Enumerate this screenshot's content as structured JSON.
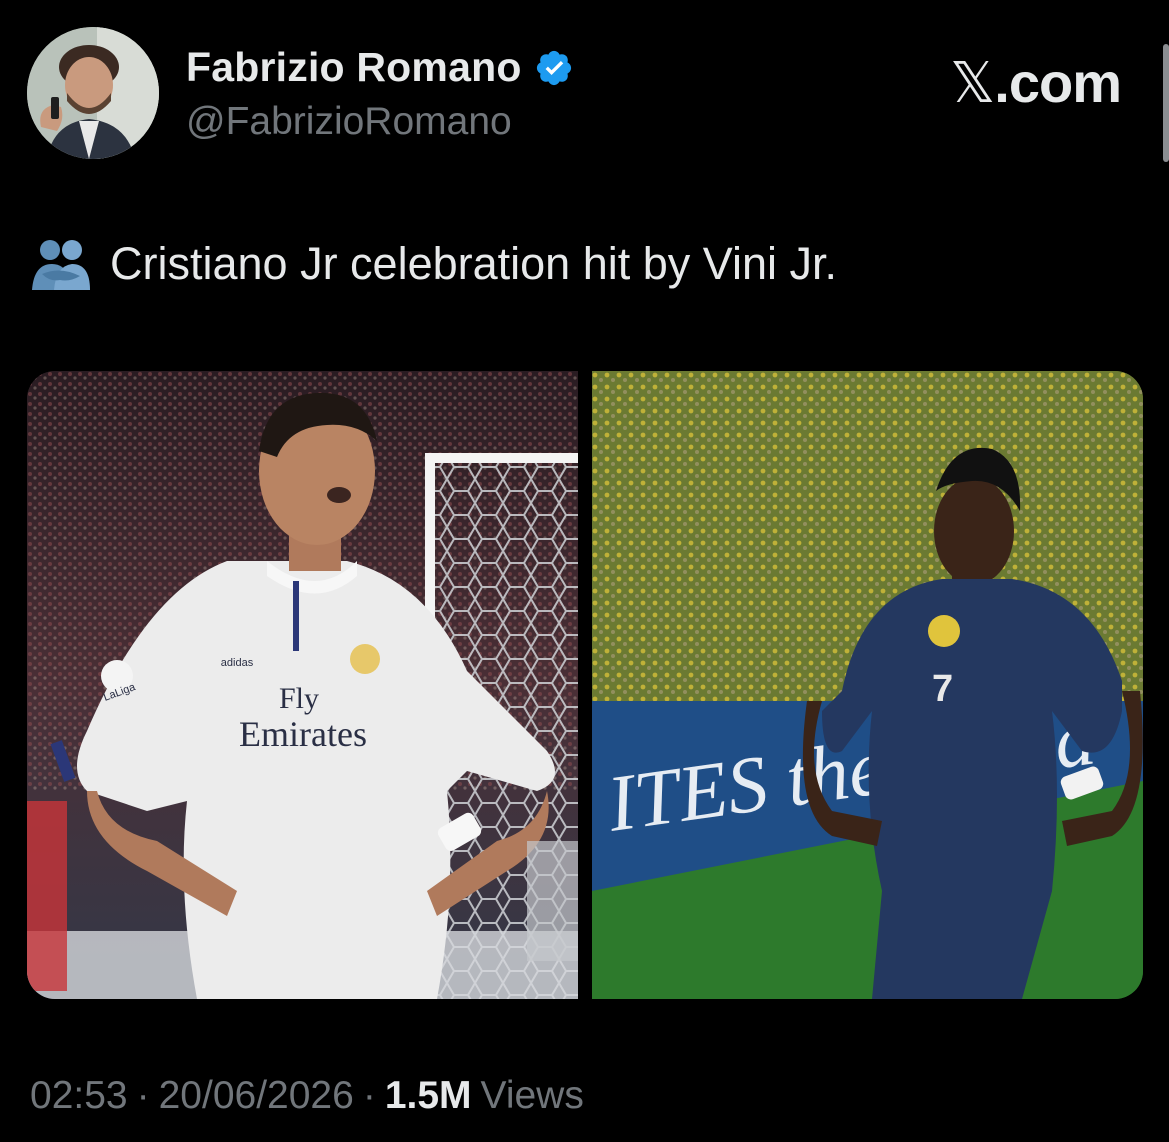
{
  "author": {
    "name": "Fabrizio Romano",
    "handle": "@FabrizioRomano",
    "verified": true
  },
  "brand": {
    "logo_mark": "𝕏",
    "logo_suffix": ".com"
  },
  "tweet": {
    "emoji_icon": "people-hugging-icon",
    "text": "Cristiano Jr celebration hit by Vini Jr."
  },
  "media": [
    {
      "description_icon": "photo-left",
      "jersey_sponsor": "Fly",
      "jersey_sponsor_line2": "Emirates",
      "kit_brand": "adidas",
      "sleeve_badge": "LaLiga"
    },
    {
      "description_icon": "photo-right",
      "shirt_number": "7",
      "board_text": "ITES the World"
    }
  ],
  "meta": {
    "time": "02:53",
    "separator": "·",
    "date": "20/06/2026",
    "views_count": "1.5M",
    "views_label": "Views"
  },
  "colors": {
    "background": "#000000",
    "primary_text": "#e7e9ea",
    "secondary_text": "#71767b",
    "verified_blue": "#1d9bf0"
  }
}
